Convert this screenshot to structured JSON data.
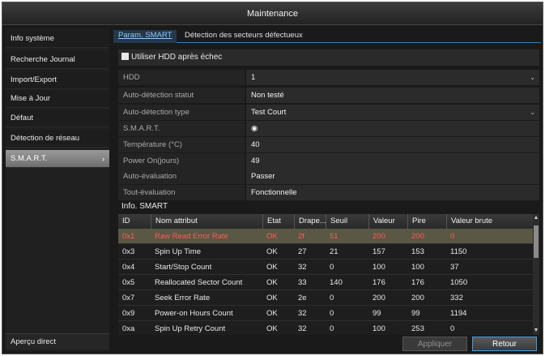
{
  "window": {
    "title": "Maintenance"
  },
  "sidebar": {
    "items": [
      {
        "label": "Info système"
      },
      {
        "label": "Recherche Journal"
      },
      {
        "label": "Import/Export"
      },
      {
        "label": "Mise à Jour"
      },
      {
        "label": "Défaut"
      },
      {
        "label": "Détection de réseau"
      },
      {
        "label": "S.M.A.R.T.",
        "active": true,
        "chevron": "›"
      }
    ],
    "bottom_label": "Aperçu direct"
  },
  "tabs": [
    {
      "label": "Param. SMART",
      "active": true
    },
    {
      "label": "Détection des secteurs défectueux",
      "active": false
    }
  ],
  "checkbox": {
    "label": "Utiliser HDD après échec",
    "checked": true
  },
  "fields": [
    {
      "label": "HDD",
      "value": "1",
      "dropdown": true
    },
    {
      "label": "Auto-détection statut",
      "value": "Non testé",
      "dropdown": false
    },
    {
      "label": "Auto-détection type",
      "value": "Test Court",
      "dropdown": true
    },
    {
      "label": "S.M.A.R.T.",
      "value": "◉",
      "dropdown": false
    },
    {
      "label": "Température (°C)",
      "value": "40",
      "dropdown": false
    },
    {
      "label": "Power On(jours)",
      "value": "49",
      "dropdown": false
    },
    {
      "label": "Auto-évaluation",
      "value": "Passer",
      "dropdown": false
    },
    {
      "label": "Tout-évaluation",
      "value": "Fonctionnelle",
      "dropdown": false
    }
  ],
  "smart_info": {
    "title": "Info. SMART",
    "columns": [
      "ID",
      "Nom attribut",
      "Etat",
      "Drape...",
      "Seuil",
      "Valeur",
      "Pire",
      "Valeur brute"
    ],
    "rows": [
      [
        "0x1",
        "Raw Read Error Rate",
        "OK",
        "2f",
        "51",
        "200",
        "200",
        "0"
      ],
      [
        "0x3",
        "Spin Up Time",
        "OK",
        "27",
        "21",
        "157",
        "153",
        "1150"
      ],
      [
        "0x4",
        "Start/Stop Count",
        "OK",
        "32",
        "0",
        "100",
        "100",
        "37"
      ],
      [
        "0x5",
        "Reallocated Sector Count",
        "OK",
        "33",
        "140",
        "176",
        "176",
        "1050"
      ],
      [
        "0x7",
        "Seek Error Rate",
        "OK",
        "2e",
        "0",
        "200",
        "200",
        "332"
      ],
      [
        "0x9",
        "Power-on Hours Count",
        "OK",
        "32",
        "0",
        "99",
        "99",
        "1194"
      ],
      [
        "0xa",
        "Spin Up Retry Count",
        "OK",
        "32",
        "0",
        "100",
        "253",
        "0"
      ]
    ],
    "selected_row": 0
  },
  "buttons": {
    "apply": "Appliquer",
    "back": "Retour"
  },
  "colors": {
    "accent": "#3c7fb0",
    "selected_row_bg": "#5a5744",
    "selected_row_text": "#ff5a5a"
  }
}
